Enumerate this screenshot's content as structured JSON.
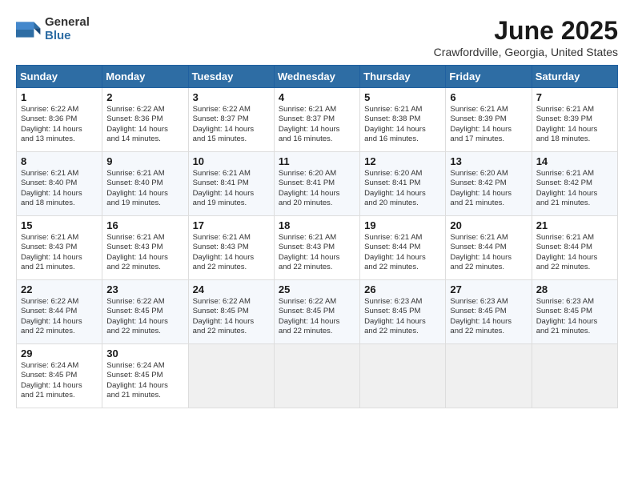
{
  "header": {
    "logo_line1": "General",
    "logo_line2": "Blue",
    "month_title": "June 2025",
    "location": "Crawfordville, Georgia, United States"
  },
  "days_of_week": [
    "Sunday",
    "Monday",
    "Tuesday",
    "Wednesday",
    "Thursday",
    "Friday",
    "Saturday"
  ],
  "weeks": [
    [
      {
        "day": "1",
        "sunrise": "6:22 AM",
        "sunset": "8:36 PM",
        "daylight_hours": "14",
        "daylight_mins": "13"
      },
      {
        "day": "2",
        "sunrise": "6:22 AM",
        "sunset": "8:36 PM",
        "daylight_hours": "14",
        "daylight_mins": "14"
      },
      {
        "day": "3",
        "sunrise": "6:22 AM",
        "sunset": "8:37 PM",
        "daylight_hours": "14",
        "daylight_mins": "15"
      },
      {
        "day": "4",
        "sunrise": "6:21 AM",
        "sunset": "8:37 PM",
        "daylight_hours": "14",
        "daylight_mins": "16"
      },
      {
        "day": "5",
        "sunrise": "6:21 AM",
        "sunset": "8:38 PM",
        "daylight_hours": "14",
        "daylight_mins": "16"
      },
      {
        "day": "6",
        "sunrise": "6:21 AM",
        "sunset": "8:39 PM",
        "daylight_hours": "14",
        "daylight_mins": "17"
      },
      {
        "day": "7",
        "sunrise": "6:21 AM",
        "sunset": "8:39 PM",
        "daylight_hours": "14",
        "daylight_mins": "18"
      }
    ],
    [
      {
        "day": "8",
        "sunrise": "6:21 AM",
        "sunset": "8:40 PM",
        "daylight_hours": "14",
        "daylight_mins": "18"
      },
      {
        "day": "9",
        "sunrise": "6:21 AM",
        "sunset": "8:40 PM",
        "daylight_hours": "14",
        "daylight_mins": "19"
      },
      {
        "day": "10",
        "sunrise": "6:21 AM",
        "sunset": "8:41 PM",
        "daylight_hours": "14",
        "daylight_mins": "19"
      },
      {
        "day": "11",
        "sunrise": "6:20 AM",
        "sunset": "8:41 PM",
        "daylight_hours": "14",
        "daylight_mins": "20"
      },
      {
        "day": "12",
        "sunrise": "6:20 AM",
        "sunset": "8:41 PM",
        "daylight_hours": "14",
        "daylight_mins": "20"
      },
      {
        "day": "13",
        "sunrise": "6:20 AM",
        "sunset": "8:42 PM",
        "daylight_hours": "14",
        "daylight_mins": "21"
      },
      {
        "day": "14",
        "sunrise": "6:21 AM",
        "sunset": "8:42 PM",
        "daylight_hours": "14",
        "daylight_mins": "21"
      }
    ],
    [
      {
        "day": "15",
        "sunrise": "6:21 AM",
        "sunset": "8:43 PM",
        "daylight_hours": "14",
        "daylight_mins": "21"
      },
      {
        "day": "16",
        "sunrise": "6:21 AM",
        "sunset": "8:43 PM",
        "daylight_hours": "14",
        "daylight_mins": "22"
      },
      {
        "day": "17",
        "sunrise": "6:21 AM",
        "sunset": "8:43 PM",
        "daylight_hours": "14",
        "daylight_mins": "22"
      },
      {
        "day": "18",
        "sunrise": "6:21 AM",
        "sunset": "8:43 PM",
        "daylight_hours": "14",
        "daylight_mins": "22"
      },
      {
        "day": "19",
        "sunrise": "6:21 AM",
        "sunset": "8:44 PM",
        "daylight_hours": "14",
        "daylight_mins": "22"
      },
      {
        "day": "20",
        "sunrise": "6:21 AM",
        "sunset": "8:44 PM",
        "daylight_hours": "14",
        "daylight_mins": "22"
      },
      {
        "day": "21",
        "sunrise": "6:21 AM",
        "sunset": "8:44 PM",
        "daylight_hours": "14",
        "daylight_mins": "22"
      }
    ],
    [
      {
        "day": "22",
        "sunrise": "6:22 AM",
        "sunset": "8:44 PM",
        "daylight_hours": "14",
        "daylight_mins": "22"
      },
      {
        "day": "23",
        "sunrise": "6:22 AM",
        "sunset": "8:45 PM",
        "daylight_hours": "14",
        "daylight_mins": "22"
      },
      {
        "day": "24",
        "sunrise": "6:22 AM",
        "sunset": "8:45 PM",
        "daylight_hours": "14",
        "daylight_mins": "22"
      },
      {
        "day": "25",
        "sunrise": "6:22 AM",
        "sunset": "8:45 PM",
        "daylight_hours": "14",
        "daylight_mins": "22"
      },
      {
        "day": "26",
        "sunrise": "6:23 AM",
        "sunset": "8:45 PM",
        "daylight_hours": "14",
        "daylight_mins": "22"
      },
      {
        "day": "27",
        "sunrise": "6:23 AM",
        "sunset": "8:45 PM",
        "daylight_hours": "14",
        "daylight_mins": "22"
      },
      {
        "day": "28",
        "sunrise": "6:23 AM",
        "sunset": "8:45 PM",
        "daylight_hours": "14",
        "daylight_mins": "21"
      }
    ],
    [
      {
        "day": "29",
        "sunrise": "6:24 AM",
        "sunset": "8:45 PM",
        "daylight_hours": "14",
        "daylight_mins": "21"
      },
      {
        "day": "30",
        "sunrise": "6:24 AM",
        "sunset": "8:45 PM",
        "daylight_hours": "14",
        "daylight_mins": "21"
      },
      null,
      null,
      null,
      null,
      null
    ]
  ],
  "labels": {
    "sunrise": "Sunrise:",
    "sunset": "Sunset:",
    "daylight": "Daylight: ",
    "hours": "hours",
    "and": "and",
    "minutes": "minutes."
  }
}
